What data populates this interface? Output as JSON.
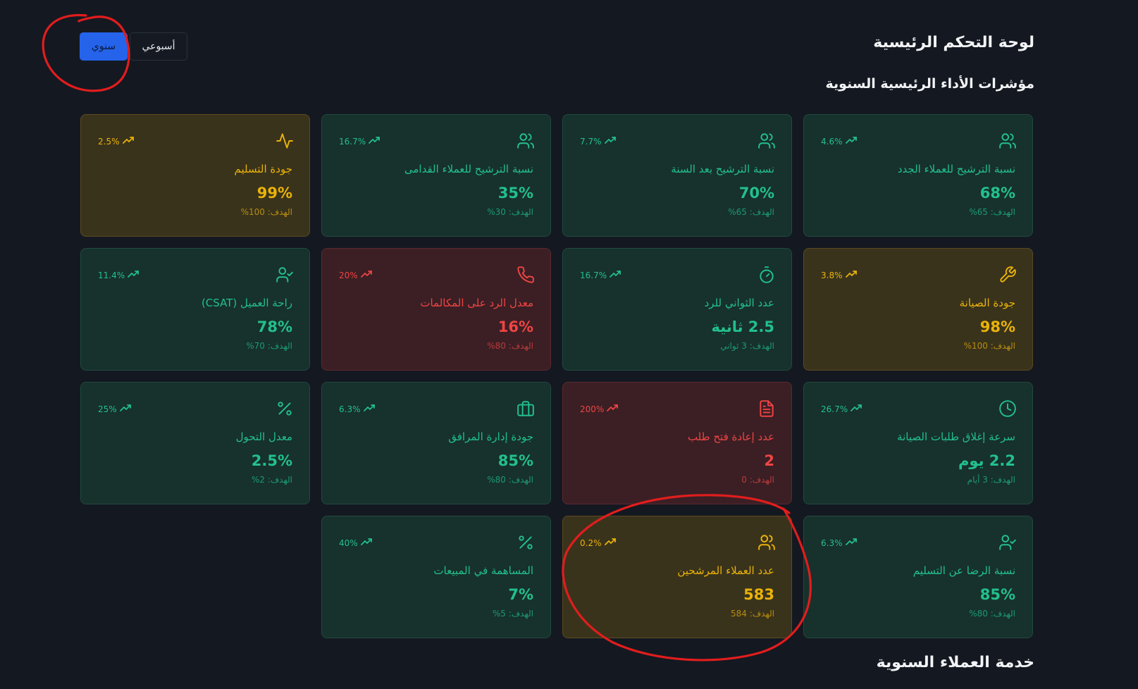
{
  "header": {
    "title": "لوحة التحكم الرئيسية",
    "section_title": "مؤشرات الأداء الرئيسية السنوية",
    "section_title_2": "خدمة العملاء السنوية"
  },
  "period_toggle": {
    "annual_label": "سنوي",
    "weekly_label": "أسبوعي",
    "selected": "annual",
    "selected_color": "#2563eb"
  },
  "colors": {
    "good": "#22c08c",
    "warning": "#eab308",
    "bad": "#ef4444"
  },
  "kpis": [
    {
      "label": "نسبة الترشيح للعملاء الجدد",
      "value": "68%",
      "target": "الهدف: 65%",
      "trend": "4.6%",
      "status": "green",
      "icon": "users-icon"
    },
    {
      "label": "نسبة الترشيح بعد السنة",
      "value": "70%",
      "target": "الهدف: 65%",
      "trend": "7.7%",
      "status": "green",
      "icon": "users-icon"
    },
    {
      "label": "نسبة الترشيح للعملاء القدامى",
      "value": "35%",
      "target": "الهدف: 30%",
      "trend": "16.7%",
      "status": "green",
      "icon": "users-icon"
    },
    {
      "label": "جودة التسليم",
      "value": "99%",
      "target": "الهدف: 100%",
      "trend": "2.5%",
      "status": "yellow",
      "icon": "activity-icon"
    },
    {
      "label": "جودة الصيانة",
      "value": "98%",
      "target": "الهدف: 100%",
      "trend": "3.8%",
      "status": "yellow",
      "icon": "wrench-icon"
    },
    {
      "label": "عدد الثواني للرد",
      "value": "2.5 ثانية",
      "target": "الهدف: 3 ثواني",
      "trend": "16.7%",
      "status": "green",
      "icon": "timer-icon"
    },
    {
      "label": "معدل الرد على المكالمات",
      "value": "16%",
      "target": "الهدف: 80%",
      "trend": "20%",
      "status": "red",
      "icon": "phone-icon"
    },
    {
      "label": "راحة العميل (CSAT)",
      "value": "78%",
      "target": "الهدف: 70%",
      "trend": "11.4%",
      "status": "green",
      "icon": "user-check-icon"
    },
    {
      "label": "سرعة إغلاق طلبات الصيانة",
      "value": "2.2 يوم",
      "target": "الهدف: 3 أيام",
      "trend": "26.7%",
      "status": "green",
      "icon": "clock-icon"
    },
    {
      "label": "عدد إعادة فتح طلب",
      "value": "2",
      "target": "الهدف: 0",
      "trend": "200%",
      "status": "red",
      "icon": "file-text-icon"
    },
    {
      "label": "جودة إدارة المرافق",
      "value": "85%",
      "target": "الهدف: 80%",
      "trend": "6.3%",
      "status": "green",
      "icon": "briefcase-icon"
    },
    {
      "label": "معدل التحول",
      "value": "2.5%",
      "target": "الهدف: 2%",
      "trend": "25%",
      "status": "green",
      "icon": "percent-icon"
    },
    {
      "label": "نسبة الرضا عن التسليم",
      "value": "85%",
      "target": "الهدف: 80%",
      "trend": "6.3%",
      "status": "green",
      "icon": "user-check-icon"
    },
    {
      "label": "عدد العملاء المرشحين",
      "value": "583",
      "target": "الهدف: 584",
      "trend": "0.2%",
      "status": "yellow",
      "icon": "users-icon"
    },
    {
      "label": "المساهمة في المبيعات",
      "value": "7%",
      "target": "الهدف: 5%",
      "trend": "40%",
      "status": "green",
      "icon": "percent-icon"
    }
  ]
}
